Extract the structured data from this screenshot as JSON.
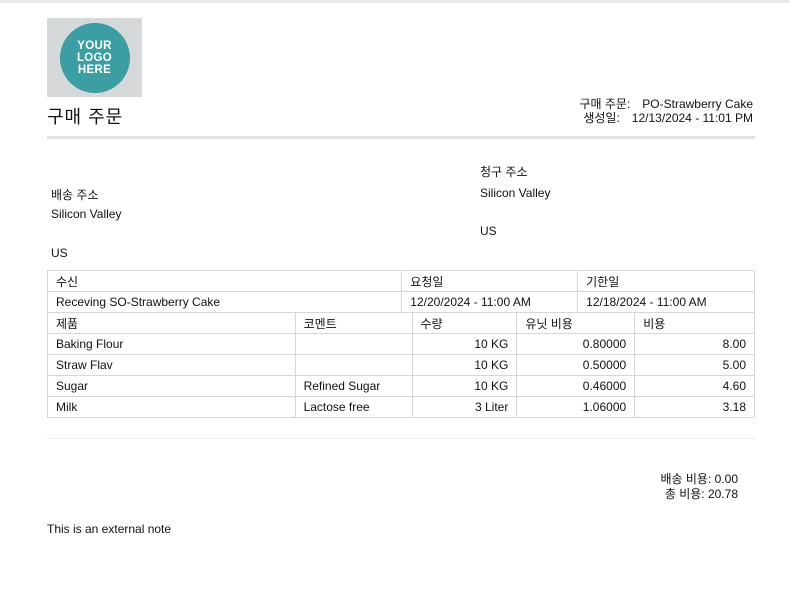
{
  "logo": {
    "lines": [
      "YOUR",
      "LOGO",
      "HERE"
    ]
  },
  "title": "구매 주문",
  "meta": {
    "po_label": "구매 주문:",
    "po_value": "PO-Strawberry Cake",
    "created_label": "생성일:",
    "created_value": "12/13/2024 - 11:01 PM"
  },
  "shipping": {
    "label": "배송 주소",
    "line1": "Silicon Valley",
    "country": "US"
  },
  "billing": {
    "label": "청구 주소",
    "line1": "Silicon Valley",
    "country": "US"
  },
  "info_table": {
    "headers": [
      "수신",
      "요청일",
      "기한일"
    ],
    "values": [
      "Receving SO-Strawberry Cake",
      "12/20/2024 - 11:00 AM",
      "12/18/2024 - 11:00 AM"
    ]
  },
  "items_table": {
    "headers": [
      "제품",
      "코멘트",
      "수량",
      "유닛 비용",
      "비용"
    ],
    "rows": [
      [
        "Baking Flour",
        "",
        "10 KG",
        "0.80000",
        "8.00"
      ],
      [
        "Straw Flav",
        "",
        "10 KG",
        "0.50000",
        "5.00"
      ],
      [
        "Sugar",
        "Refined Sugar",
        "10 KG",
        "0.46000",
        "4.60"
      ],
      [
        "Milk",
        "Lactose free",
        "3 Liter",
        "1.06000",
        "3.18"
      ]
    ]
  },
  "totals": {
    "shipping": "배송 비용: 0.00",
    "total": "총 비용: 20.78"
  },
  "note": "This is an external note"
}
